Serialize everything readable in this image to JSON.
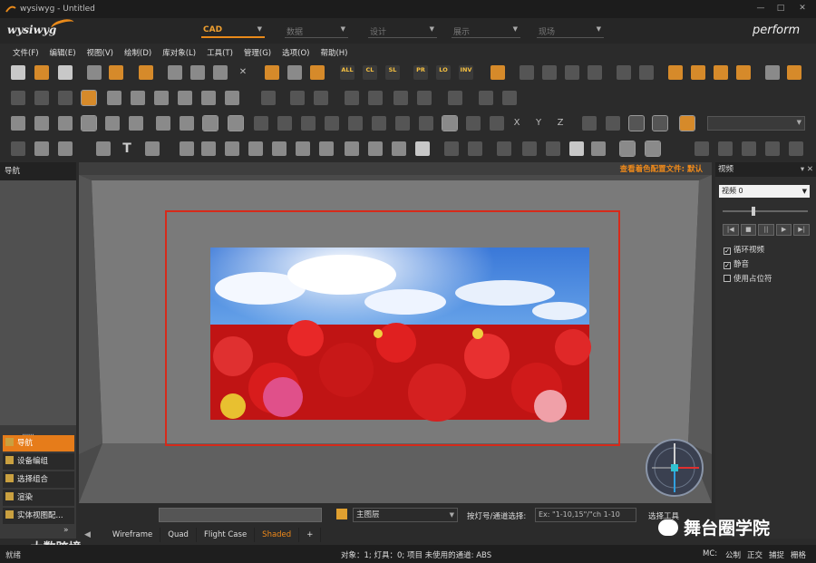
{
  "window": {
    "title": "wysiwyg - Untitled",
    "min": "—",
    "max": "□",
    "close": "✕"
  },
  "logobar": {
    "logo": "wysiwyg",
    "perform": "perform",
    "modes": [
      {
        "label": "CAD",
        "active": true
      },
      {
        "label": "数据",
        "active": false
      },
      {
        "label": "设计",
        "active": false
      },
      {
        "label": "展示",
        "active": false
      },
      {
        "label": "现场",
        "active": false
      }
    ]
  },
  "menu": [
    "文件(F)",
    "编辑(E)",
    "视图(V)",
    "绘制(D)",
    "库对象(L)",
    "工具(T)",
    "管理(G)",
    "选项(O)",
    "帮助(H)"
  ],
  "toolbar_labels": {
    "all": "ALL",
    "cl": "CL",
    "sl": "SL",
    "pr": "PR",
    "lo": "LO",
    "inv": "INV"
  },
  "nav": {
    "header": "导航",
    "grip": "......",
    "items": [
      {
        "label": "导航",
        "active": true
      },
      {
        "label": "设备编组",
        "active": false
      },
      {
        "label": "选择组合",
        "active": false
      },
      {
        "label": "渲染",
        "active": false
      },
      {
        "label": "实体视图配...",
        "active": false
      }
    ],
    "more": "»"
  },
  "viewport": {
    "config_text": "查看着色配置文件: 默认"
  },
  "video_panel": {
    "header": "视频",
    "select_value": "视频 0",
    "checks": [
      {
        "label": "循环视频",
        "checked": true
      },
      {
        "label": "静音",
        "checked": true
      },
      {
        "label": "使用占位符",
        "checked": false
      }
    ]
  },
  "status": {
    "layer": "主图层",
    "fixture_label": "按灯号/通道选择:",
    "fixture_placeholder": "Ex: \"1-10,15\"/\"ch 1-10",
    "tool_text": "选择工具"
  },
  "tabs": [
    "Wireframe",
    "Quad",
    "Flight Case",
    "Shaded",
    "+"
  ],
  "bottom": {
    "left": "就绪",
    "info": "对象：1; 灯具：0; 项目 未使用的通道: ABS",
    "right_items": [
      "MC:",
      "公制",
      "正交",
      "捕捉",
      "栅格"
    ]
  },
  "watermarks": {
    "left": "大数跨境",
    "right": "舞台圈学院"
  },
  "colors": {
    "accent": "#e67c1a",
    "screen_border": "#d62a1a",
    "sky": "#2a6cd0",
    "flowers": "#d01818"
  }
}
